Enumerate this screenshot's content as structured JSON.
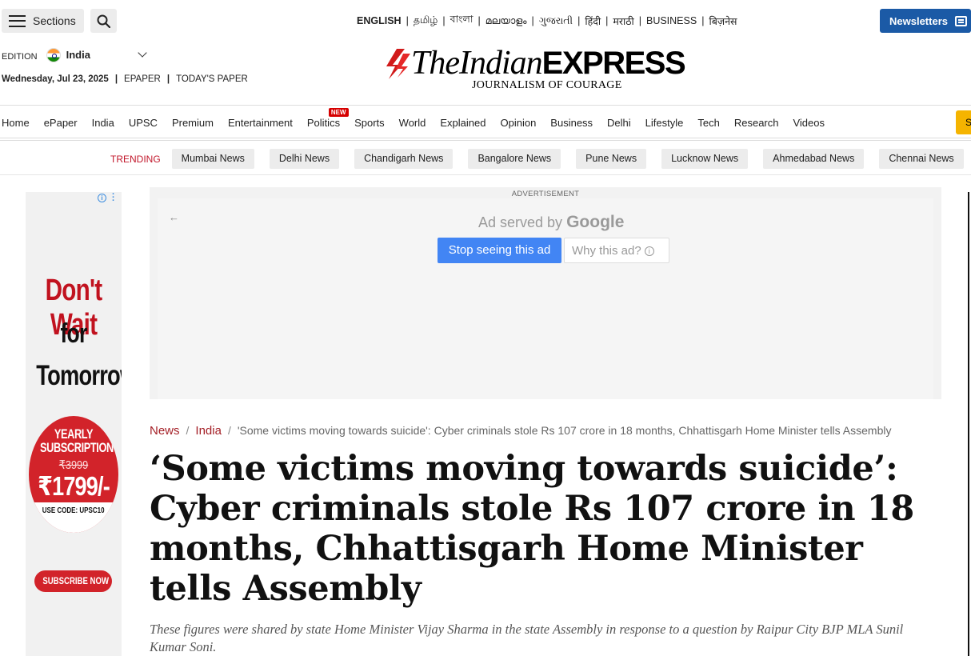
{
  "header": {
    "sections_label": "Sections",
    "languages": [
      "ENGLISH",
      "தமிழ்",
      "বাংলা",
      "മലയാളം",
      "ગુજરાતી",
      "हिंदी",
      "मराठी",
      "BUSINESS",
      "बिज़नेस"
    ],
    "newsletters_label": "Newsletters"
  },
  "edition": {
    "label": "EDITION",
    "value": "India"
  },
  "dateline": {
    "date": "Wednesday, Jul 23, 2025",
    "epaper": "EPAPER",
    "todays_paper": "TODAY'S PAPER"
  },
  "logo": {
    "the": "The",
    "indian": "Indian",
    "express": "EXPRESS",
    "tagline": "JOURNALISM OF COURAGE"
  },
  "nav": {
    "items": [
      "Home",
      "ePaper",
      "India",
      "UPSC",
      "Premium",
      "Entertainment",
      "Politics",
      "Sports",
      "World",
      "Explained",
      "Opinion",
      "Business",
      "Delhi",
      "Lifestyle",
      "Tech",
      "Research",
      "Videos"
    ],
    "new_badge": "NEW",
    "yellow_button": "S"
  },
  "trending": {
    "label": "TRENDING",
    "items": [
      "Mumbai News",
      "Delhi News",
      "Chandigarh News",
      "Bangalore News",
      "Pune News",
      "Lucknow News",
      "Ahmedabad News",
      "Chennai News"
    ]
  },
  "left_ad": {
    "line1": "Don't Wait",
    "line2": "for",
    "line3": "Tomorrow",
    "yearly": "YEARLY SUBSCRIPTION",
    "old_price": "₹3999",
    "new_price": "₹1799/-",
    "code": "USE CODE: UPSC10",
    "cta": "SUBSCRIBE NOW"
  },
  "center_ad": {
    "label": "ADVERTISEMENT",
    "served_by": "Ad served by",
    "google": "Google",
    "stop_label": "Stop seeing this ad",
    "why_label": "Why this ad?"
  },
  "breadcrumb": {
    "news": "News",
    "india": "India",
    "current": "'Some victims moving towards suicide': Cyber criminals stole Rs 107 crore in 18 months, Chhattisgarh Home Minister tells Assembly"
  },
  "article": {
    "headline": "‘Some victims moving towards suicide’: Cyber criminals stole Rs 107 crore in 18 months, Chhattisgarh Home Minister tells Assembly",
    "synopsis": "These figures were shared by state Home Minister Vijay Sharma in the state Assembly in response to a question by Raipur City BJP MLA Sunil Kumar Soni."
  },
  "colors": {
    "brand_red": "#a41f26",
    "newsletter_blue": "#1b5aa6",
    "trending_red": "#c2172b",
    "ad_blue": "#4285f4"
  }
}
